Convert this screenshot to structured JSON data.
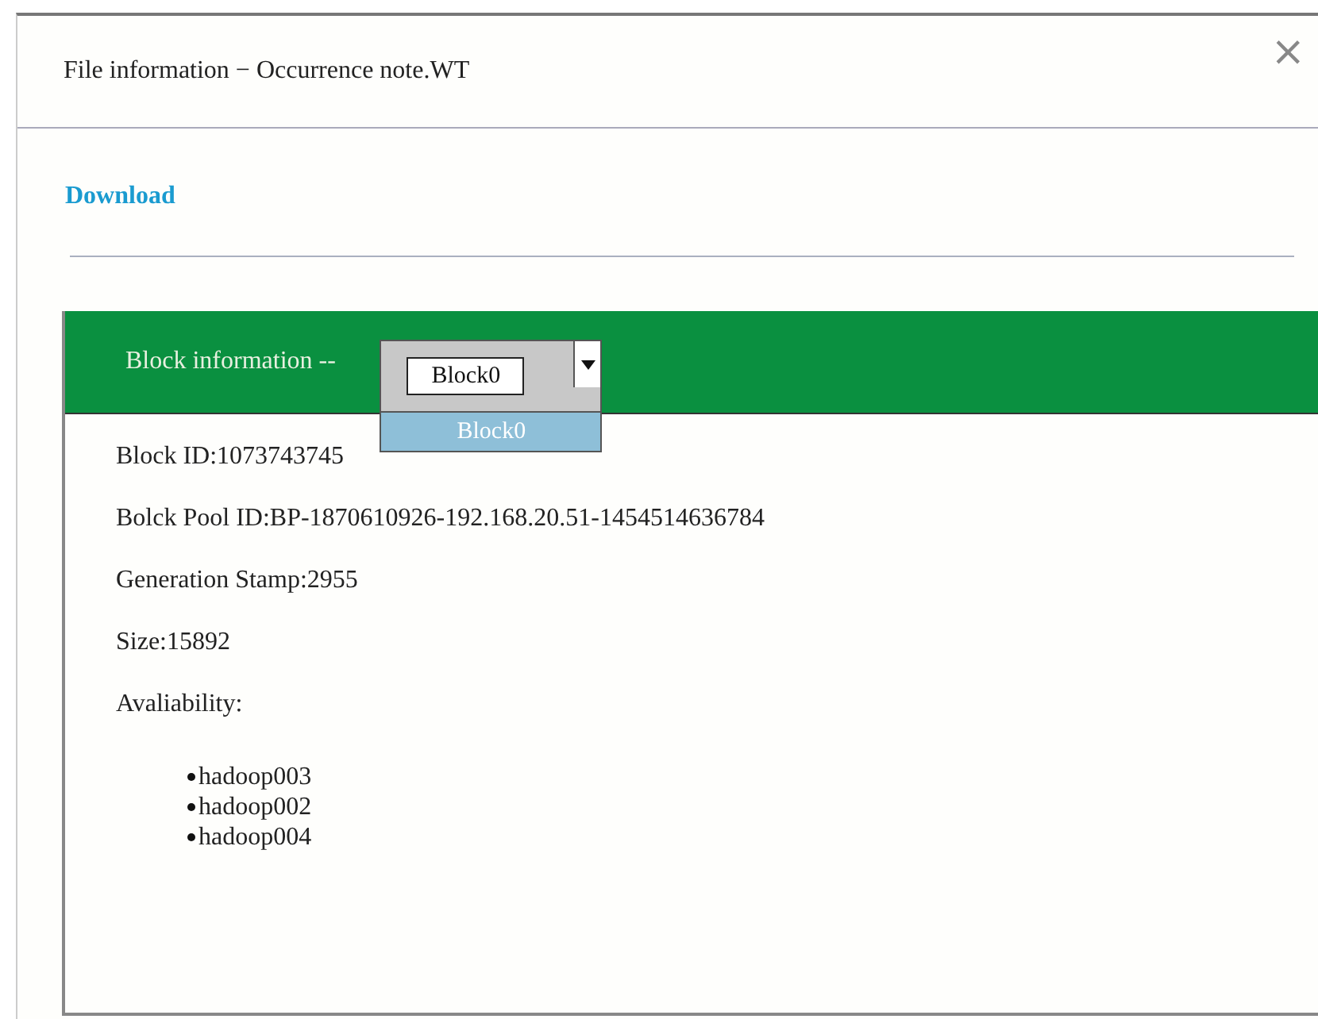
{
  "dialog": {
    "title": "File information − Occurrence note.WT",
    "close": "×"
  },
  "download_link": "Download",
  "block_panel": {
    "label": "Block information --",
    "dropdown": {
      "value": "Block0",
      "expanded": true,
      "options": [
        {
          "label": "Block0",
          "selected": true
        }
      ]
    }
  },
  "details": [
    {
      "text": "Block ID:1073743745"
    },
    {
      "text": "Bolck Pool ID:BP-1870610926-192.168.20.51-1454514636784"
    },
    {
      "text": "Generation Stamp:2955"
    },
    {
      "text": "Size:15892"
    },
    {
      "text": "Avaliability:"
    }
  ],
  "nodes": [
    "hadoop003",
    "hadoop002",
    "hadoop004"
  ]
}
